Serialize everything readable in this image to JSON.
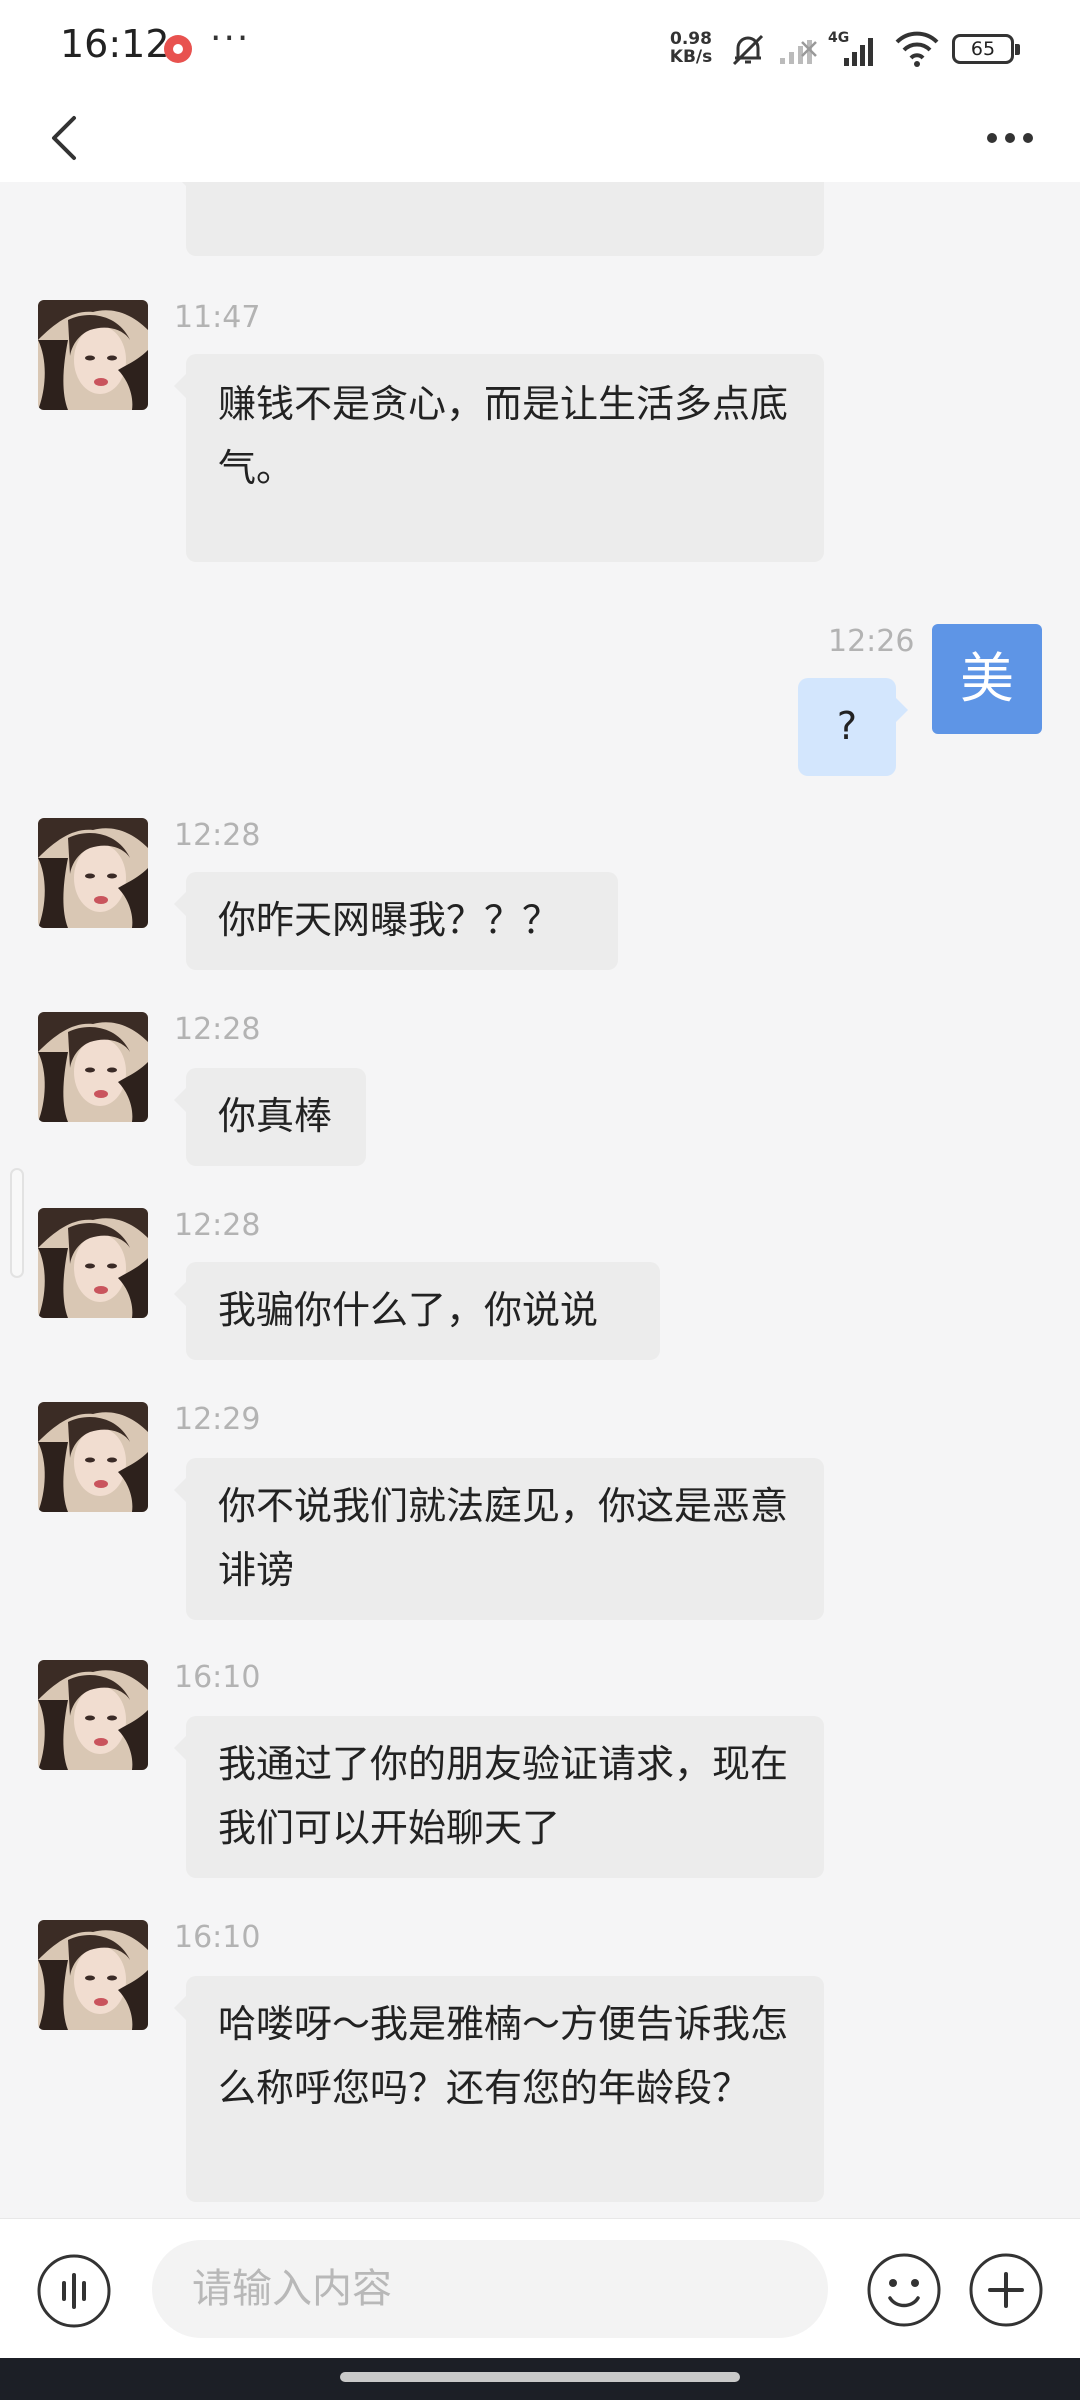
{
  "status_bar": {
    "time": "16:12",
    "dots": "···",
    "net_speed_value": "0.98",
    "net_speed_unit": "KB/s",
    "network_type": "4G",
    "battery": "65"
  },
  "nav": {
    "back_icon": "chevron-left-icon",
    "more_icon": "more-horizontal-icon"
  },
  "messages": [
    {
      "side": "in",
      "time": "",
      "text": ""
    },
    {
      "side": "in",
      "time": "11:47",
      "text": "赚钱不是贪心，而是让生活多点底气。"
    },
    {
      "side": "out",
      "time": "12:26",
      "text": "?",
      "avatar_text": "美"
    },
    {
      "side": "in",
      "time": "12:28",
      "text": "你昨天网曝我？？？"
    },
    {
      "side": "in",
      "time": "12:28",
      "text": "你真棒"
    },
    {
      "side": "in",
      "time": "12:28",
      "text": "我骗你什么了，你说说"
    },
    {
      "side": "in",
      "time": "12:29",
      "text": "你不说我们就法庭见，你这是恶意诽谤"
    },
    {
      "side": "in",
      "time": "16:10",
      "text": "我通过了你的朋友验证请求，现在我们可以开始聊天了"
    },
    {
      "side": "in",
      "time": "16:10",
      "text": "哈喽呀～我是雅楠～方便告诉我怎么称呼您吗？还有您的年龄段？"
    }
  ],
  "input_bar": {
    "placeholder": "请输入内容",
    "voice_icon": "voice-icon",
    "emoji_icon": "emoji-icon",
    "plus_icon": "plus-icon"
  },
  "colors": {
    "accent": "#5e95e6",
    "bubble_in": "#ececec",
    "bubble_out": "#d3e6fd",
    "background": "#f5f5f6"
  }
}
